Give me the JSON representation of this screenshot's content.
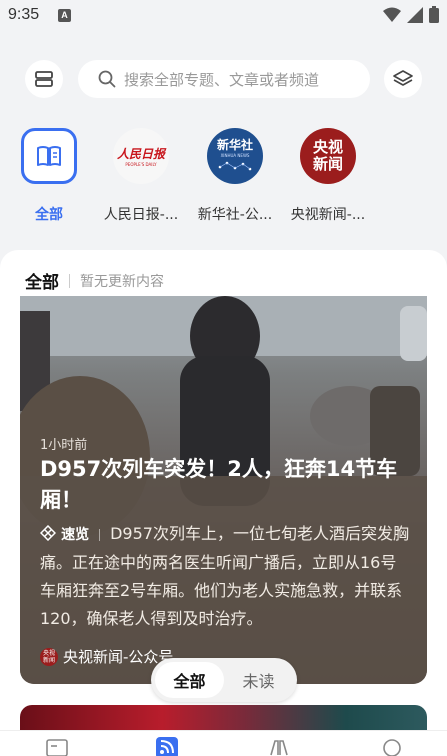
{
  "status": {
    "time": "9:35",
    "notif": "A"
  },
  "search": {
    "placeholder": "搜索全部专题、文章或者频道"
  },
  "channels": [
    {
      "label": "全部",
      "icon": "book-icon"
    },
    {
      "label": "人民日报-...",
      "logo_text": "人民日报",
      "logo_sub": "PEOPLE'S DAILY"
    },
    {
      "label": "新华社-公...",
      "logo_text": "新华社",
      "logo_sub": "XINHUA NEWS"
    },
    {
      "label": "央视新闻-...",
      "logo_text": "央视新闻"
    }
  ],
  "feed": {
    "title": "全部",
    "subtitle": "暂无更新内容"
  },
  "article": {
    "time": "1小时前",
    "title": "D957次列车突发！2人，狂奔14节车厢！",
    "quick_label": "速览",
    "summary": "D957次列车上，一位七旬老人酒后突发胸痛。正在途中的两名医生听闻广播后，立即从16号车厢狂奔至2号车厢。他们为老人实施急救，并联系120，确保老人得到及时治疗。",
    "source": "央视新闻-公众号"
  },
  "toggle": {
    "all": "全部",
    "unread": "未读"
  },
  "colors": {
    "accent": "#3a6ff0"
  }
}
